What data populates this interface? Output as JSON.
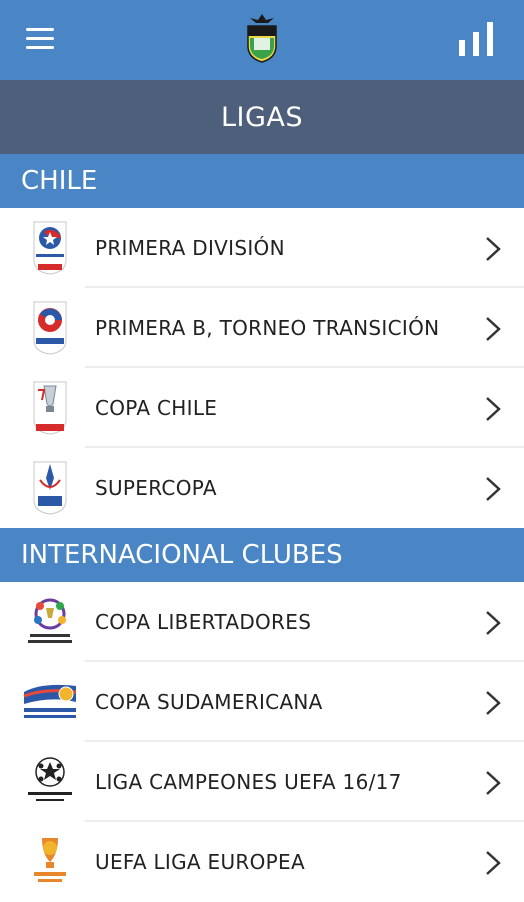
{
  "header": {
    "menu_icon": "hamburger-menu-icon",
    "logo_icon": "club-crest-logo",
    "stats_icon": "bar-chart-icon",
    "brand_color": "#4a86c5"
  },
  "title": "LIGAS",
  "sections": [
    {
      "header": "CHILE",
      "items": [
        {
          "label": "PRIMERA DIVISIÓN",
          "icon": "primera-division-logo"
        },
        {
          "label": "PRIMERA B, TORNEO TRANSICIÓN",
          "icon": "primera-b-logo"
        },
        {
          "label": "COPA CHILE",
          "icon": "copa-chile-logo"
        },
        {
          "label": "SUPERCOPA",
          "icon": "supercopa-logo"
        }
      ]
    },
    {
      "header": "INTERNACIONAL CLUBES",
      "items": [
        {
          "label": "COPA LIBERTADORES",
          "icon": "copa-libertadores-logo"
        },
        {
          "label": "COPA SUDAMERICANA",
          "icon": "copa-sudamericana-logo"
        },
        {
          "label": "LIGA CAMPEONES UEFA 16/17",
          "icon": "champions-league-logo"
        },
        {
          "label": "UEFA LIGA EUROPEA",
          "icon": "europa-league-logo"
        }
      ]
    }
  ]
}
